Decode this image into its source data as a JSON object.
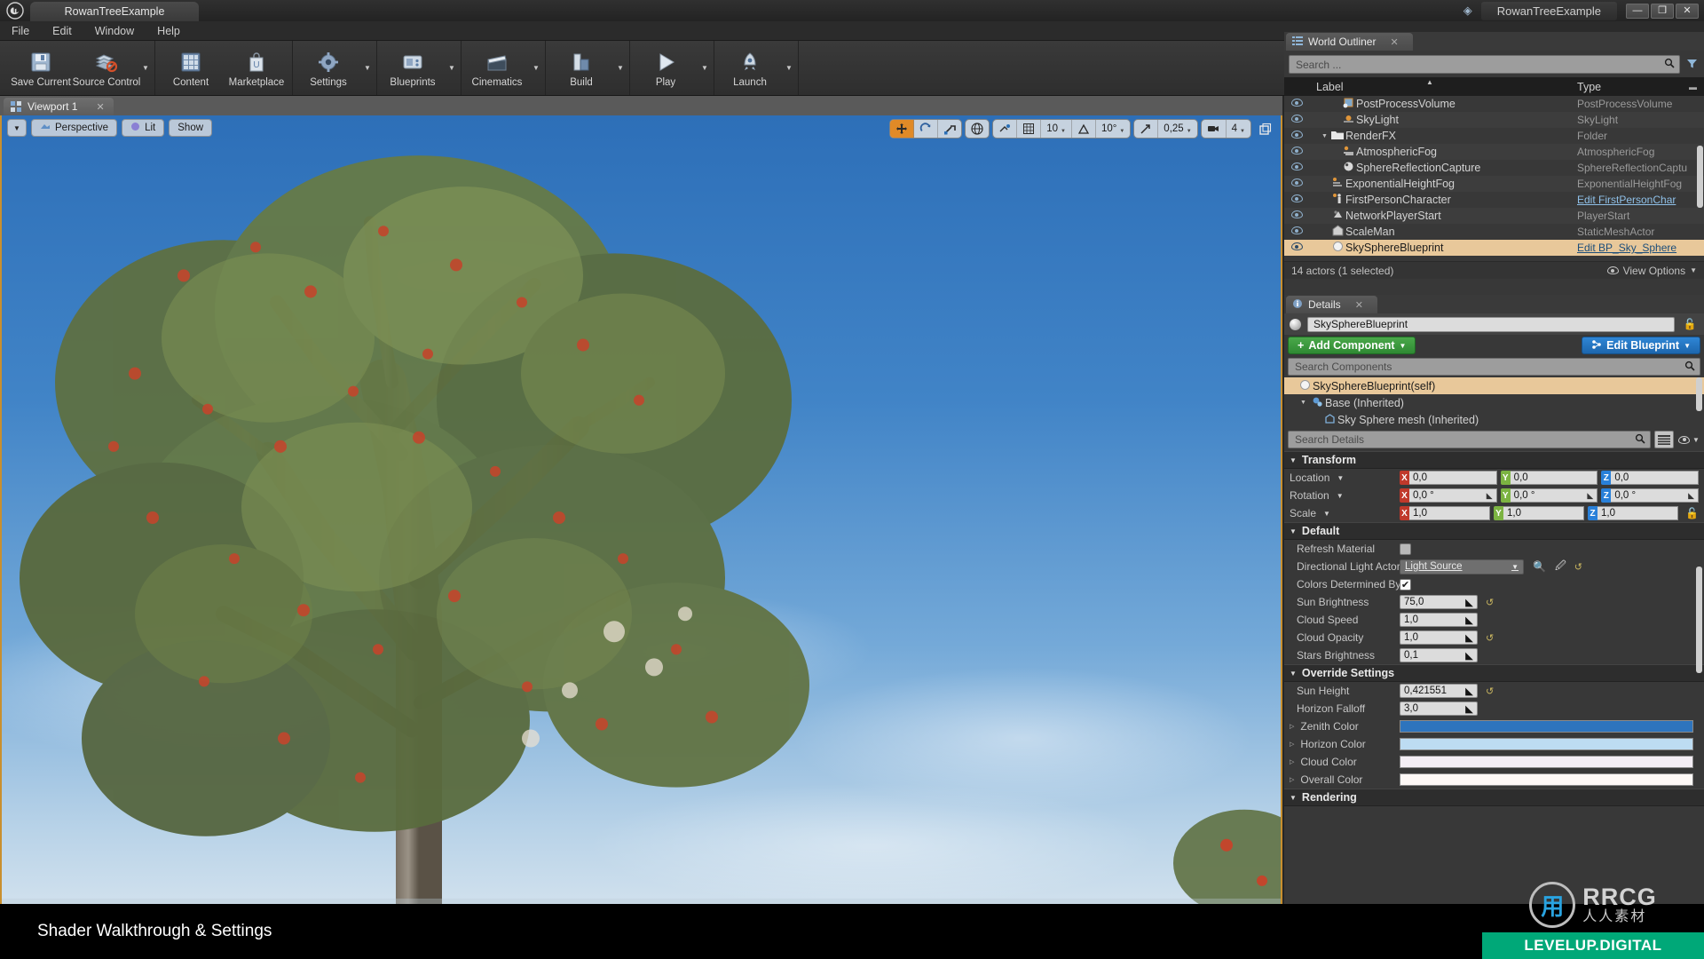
{
  "titlebar": {
    "app_icon": "unreal-logo",
    "project_tab": "RowanTreeExample",
    "project_name": "RowanTreeExample",
    "minimize": "—",
    "restore": "❐",
    "close": "✕"
  },
  "menubar": {
    "items": [
      "File",
      "Edit",
      "Window",
      "Help"
    ]
  },
  "toolbar": {
    "groups": [
      {
        "buttons": [
          {
            "label": "Save Current",
            "icon": "save-disk-icon",
            "caret": false
          },
          {
            "label": "Source Control",
            "icon": "source-control-icon",
            "caret": true
          }
        ]
      },
      {
        "buttons": [
          {
            "label": "Content",
            "icon": "content-grid-icon",
            "caret": false
          },
          {
            "label": "Marketplace",
            "icon": "marketplace-bag-icon",
            "caret": false
          }
        ]
      },
      {
        "buttons": [
          {
            "label": "Settings",
            "icon": "settings-gear-icon",
            "caret": true
          }
        ]
      },
      {
        "buttons": [
          {
            "label": "Blueprints",
            "icon": "blueprints-icon",
            "caret": true
          }
        ]
      },
      {
        "buttons": [
          {
            "label": "Cinematics",
            "icon": "cinematics-clapper-icon",
            "caret": true
          }
        ]
      },
      {
        "buttons": [
          {
            "label": "Build",
            "icon": "build-icon",
            "caret": true
          }
        ]
      },
      {
        "buttons": [
          {
            "label": "Play",
            "icon": "play-triangle-icon",
            "caret": true
          }
        ]
      },
      {
        "buttons": [
          {
            "label": "Launch",
            "icon": "launch-rocket-icon",
            "caret": true
          }
        ]
      }
    ]
  },
  "viewport": {
    "tab_label": "Viewport 1",
    "tab_close": "✕",
    "view_caret": "▼",
    "view_mode_label": "Perspective",
    "lighting_label": "Lit",
    "show_label": "Show",
    "gizmo": {
      "translate_icon": "move-gizmo-icon",
      "rotate_icon": "rotate-gizmo-icon",
      "scale_icon": "scale-gizmo-icon",
      "selected": "translate"
    },
    "coord_icon": "world-globe-icon",
    "surface_snap_icon": "surface-snap-icon",
    "grid_snap_icon": "grid-snap-icon",
    "grid_snap_value": "10",
    "angle_snap_icon": "angle-snap-icon",
    "angle_snap_value": "10°",
    "scale_snap_icon": "scale-snap-icon",
    "scale_snap_value": "0,25",
    "camera_speed_icon": "camera-speed-icon",
    "camera_speed_value": "4",
    "maximize_icon": "maximize-viewport-icon"
  },
  "outliner": {
    "tab_label": "World Outliner",
    "tab_icon": "outliner-list-icon",
    "tab_close": "✕",
    "search_placeholder": "Search ...",
    "search_icon": "search-icon",
    "filter_icon": "filter-icon",
    "columns": {
      "label": "Label",
      "type": "Type"
    },
    "rows": [
      {
        "label": "PostProcessVolume",
        "type": "PostProcessVolume",
        "icon": "postprocess-icon",
        "indent": 2,
        "expand": "",
        "link": false,
        "selected": false
      },
      {
        "label": "SkyLight",
        "type": "SkyLight",
        "icon": "skylight-icon",
        "indent": 2,
        "expand": "",
        "link": false,
        "selected": false
      },
      {
        "label": "RenderFX",
        "type": "Folder",
        "icon": "folder-icon",
        "indent": 1,
        "expand": "▼",
        "link": false,
        "selected": false
      },
      {
        "label": "AtmosphericFog",
        "type": "AtmosphericFog",
        "icon": "fog-icon",
        "indent": 2,
        "expand": "",
        "link": false,
        "selected": false
      },
      {
        "label": "SphereReflectionCapture",
        "type": "SphereReflectionCaptu",
        "icon": "reflection-icon",
        "indent": 2,
        "expand": "",
        "link": false,
        "selected": false
      },
      {
        "label": "ExponentialHeightFog",
        "type": "ExponentialHeightFog",
        "icon": "heightfog-icon",
        "indent": 1,
        "expand": "",
        "link": false,
        "selected": false
      },
      {
        "label": "FirstPersonCharacter",
        "type": "Edit FirstPersonChar",
        "icon": "character-icon",
        "indent": 1,
        "expand": "",
        "link": true,
        "selected": false
      },
      {
        "label": "NetworkPlayerStart",
        "type": "PlayerStart",
        "icon": "playerstart-icon",
        "indent": 1,
        "expand": "",
        "link": false,
        "selected": false
      },
      {
        "label": "ScaleMan",
        "type": "StaticMeshActor",
        "icon": "staticmesh-icon",
        "indent": 1,
        "expand": "",
        "link": false,
        "selected": false
      },
      {
        "label": "SkySphereBlueprint",
        "type": "Edit BP_Sky_Sphere",
        "icon": "sphere-icon",
        "indent": 1,
        "expand": "",
        "link": true,
        "selected": true
      }
    ],
    "status": "14 actors (1 selected)",
    "view_options": "View Options",
    "view_options_icon": "eye-icon"
  },
  "details": {
    "tab_label": "Details",
    "tab_icon": "details-info-icon",
    "tab_close": "✕",
    "actor_name": "SkySphereBlueprint",
    "lock_icon": "lock-open-icon",
    "add_component_label": "Add Component",
    "add_component_plus": "+",
    "add_component_caret": "▼",
    "edit_blueprint_label": "Edit Blueprint",
    "edit_blueprint_icon": "blueprint-icon",
    "edit_blueprint_caret": "▼",
    "component_search_placeholder": "Search Components",
    "component_search_icon": "search-icon",
    "components": [
      {
        "label": "SkySphereBlueprint(self)",
        "icon": "sphere-icon",
        "indent": 0,
        "expand": "",
        "selected": true
      },
      {
        "label": "Base (Inherited)",
        "icon": "base-node-icon",
        "indent": 1,
        "expand": "▼",
        "selected": false
      },
      {
        "label": "Sky Sphere mesh (Inherited)",
        "icon": "mesh-icon",
        "indent": 2,
        "expand": "",
        "selected": false
      }
    ],
    "details_search_placeholder": "Search Details",
    "details_search_icon": "search-icon",
    "list_view_icon": "list-view-icon",
    "display_options_icon": "eye-icon",
    "display_options_caret": "▼",
    "sections": [
      {
        "name": "Transform",
        "tri": "▼",
        "rows": [
          {
            "kind": "vector",
            "label": "Location",
            "dropdown": "▼",
            "x": "0,0",
            "y": "0,0",
            "z": "0,0",
            "spinner": false,
            "lock": false
          },
          {
            "kind": "vector",
            "label": "Rotation",
            "dropdown": "▼",
            "x": "0,0 °",
            "y": "0,0 °",
            "z": "0,0 °",
            "spinner": true,
            "lock": false
          },
          {
            "kind": "vector",
            "label": "Scale",
            "dropdown": "▼",
            "x": "1,0",
            "y": "1,0",
            "z": "1,0",
            "spinner": false,
            "lock": true
          }
        ]
      },
      {
        "name": "Default",
        "tri": "▼",
        "rows": [
          {
            "kind": "checkbox",
            "label": "Refresh Material",
            "checked": false,
            "reset": false
          },
          {
            "kind": "asset",
            "label": "Directional Light Actor",
            "value": "Light Source",
            "caret": "▼",
            "browse_icon": "browse-icon",
            "pick_icon": "eyedropper-icon",
            "reset": true
          },
          {
            "kind": "checkbox",
            "label": "Colors Determined By Sun P",
            "checked": true,
            "reset": false
          },
          {
            "kind": "number",
            "label": "Sun Brightness",
            "value": "75,0",
            "reset": true
          },
          {
            "kind": "number",
            "label": "Cloud Speed",
            "value": "1,0",
            "reset": false
          },
          {
            "kind": "number",
            "label": "Cloud Opacity",
            "value": "1,0",
            "reset": true
          },
          {
            "kind": "number",
            "label": "Stars Brightness",
            "value": "0,1",
            "reset": false
          }
        ]
      },
      {
        "name": "Override Settings",
        "tri": "▼",
        "rows": [
          {
            "kind": "number",
            "label": "Sun Height",
            "value": "0,421551",
            "reset": true
          },
          {
            "kind": "number",
            "label": "Horizon Falloff",
            "value": "3,0",
            "reset": false
          },
          {
            "kind": "color",
            "label": "Zenith Color",
            "tri": "▷",
            "color": "#2e74bd"
          },
          {
            "kind": "color",
            "label": "Horizon Color",
            "tri": "▷",
            "color": "#bddcf2"
          },
          {
            "kind": "color",
            "label": "Cloud Color",
            "tri": "▷",
            "color": "#f4eef5"
          },
          {
            "kind": "color",
            "label": "Overall Color",
            "tri": "▷",
            "color": "#fdf8f6"
          }
        ]
      },
      {
        "name": "Rendering",
        "tri": "▼",
        "rows": []
      }
    ]
  },
  "caption": {
    "text": "Shader Walkthrough & Settings"
  },
  "watermark": {
    "logo_mark": "RRCG-logo-icon",
    "brand": "RRCG",
    "brand_cn": "人人素材",
    "footer": "LEVELUP.DIGITAL",
    "footer_color": "#00a878"
  }
}
